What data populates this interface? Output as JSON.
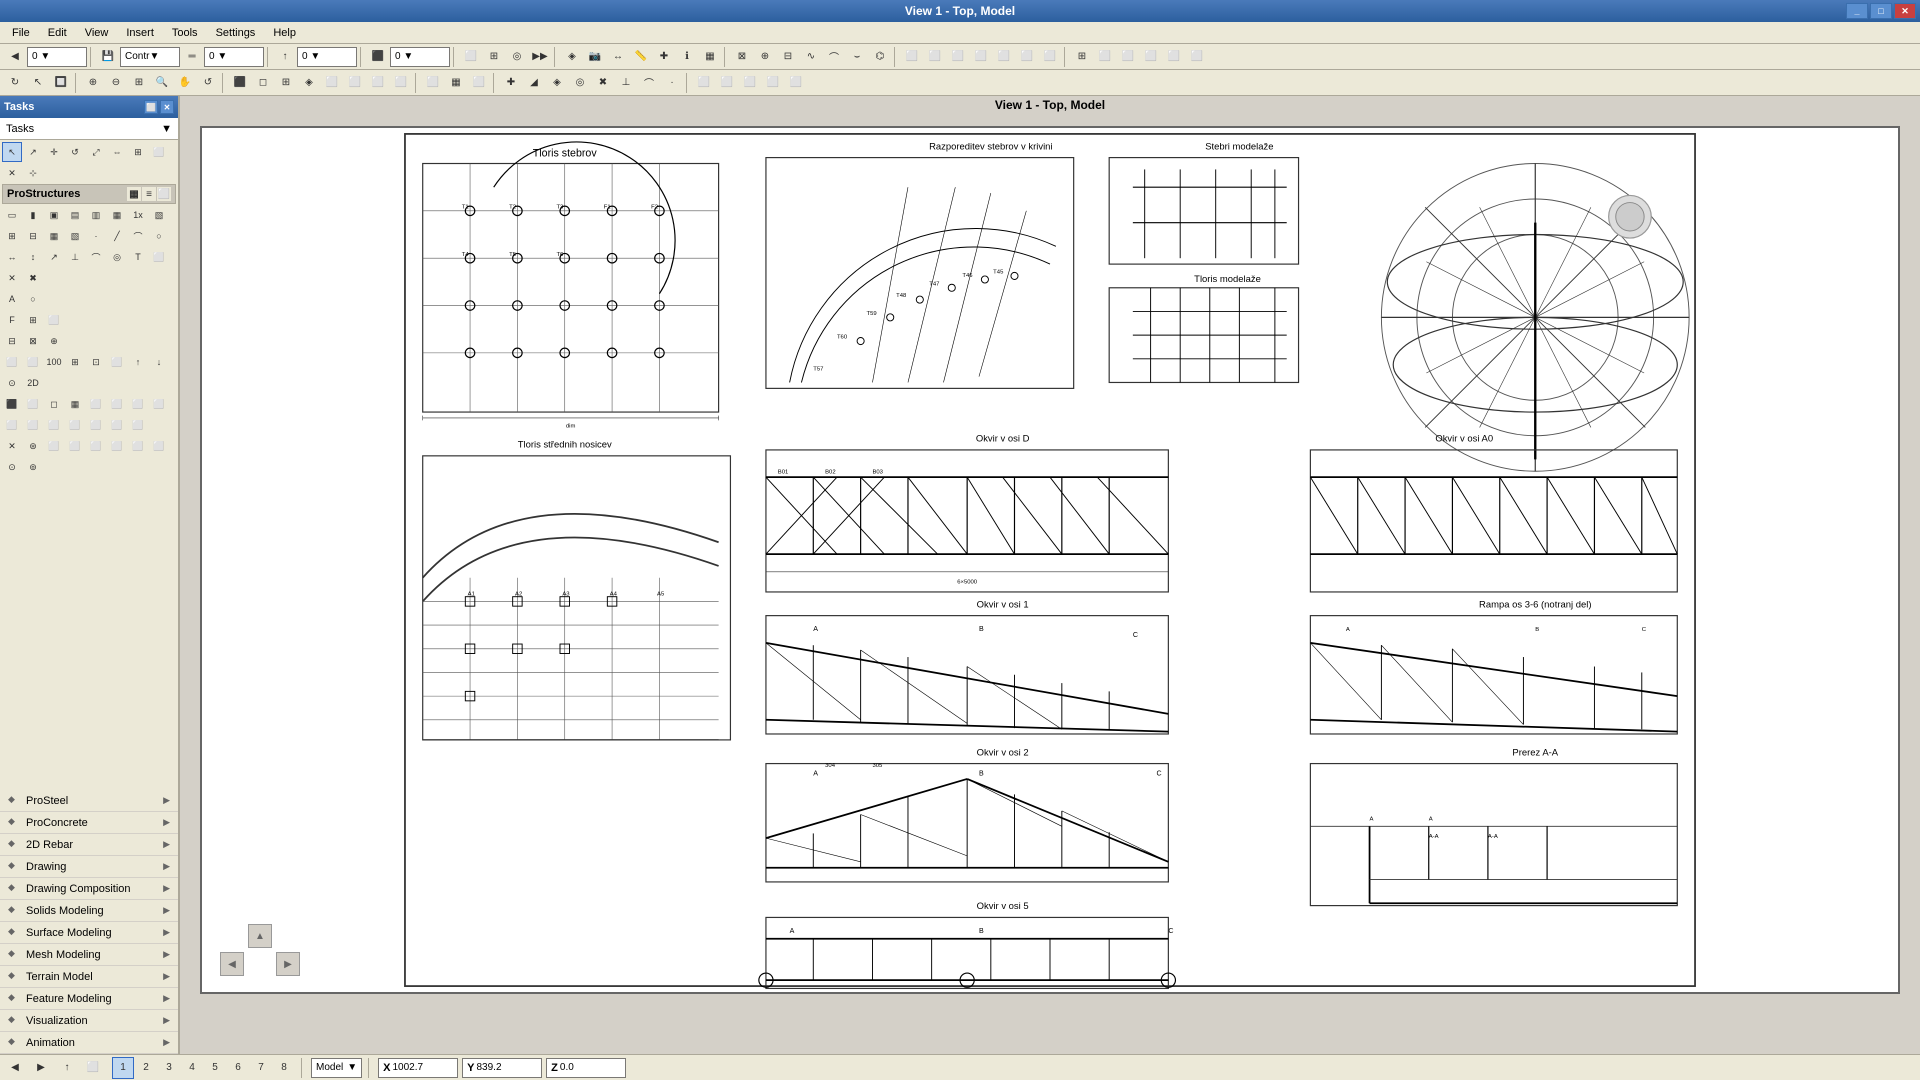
{
  "titlebar": {
    "title": "View 1 - Top, Model"
  },
  "toolbar1": {
    "dropdowns": [
      "▼",
      "0",
      "Contr▼",
      "0",
      "0",
      "0",
      "0"
    ],
    "buttons": [
      "⬛",
      "◻",
      "↩",
      "↪",
      "▶",
      "⏺",
      "📐",
      "🔧"
    ]
  },
  "toolbar2": {
    "buttons": [
      "↖",
      "↙",
      "➡",
      "⊕",
      "⊖",
      "🔲",
      "📊",
      "📋",
      "◯",
      "📏",
      "📐",
      "⬛",
      "▽",
      "△",
      "⬜",
      "❯",
      "⬜",
      "⬜",
      "⬜",
      "ℹ",
      "🔍"
    ]
  },
  "tasks_panel": {
    "header": "Tasks",
    "dropdown_label": "Tasks"
  },
  "prostructures": {
    "label": "ProStructures",
    "view_icons": [
      "grid",
      "list",
      "expand"
    ]
  },
  "tool_rows": [
    [
      "arrow",
      "select",
      "move",
      "rotate",
      "scale",
      "mirror",
      "align",
      "attach"
    ],
    [
      "x",
      "cursor"
    ],
    [
      "draw1",
      "draw2",
      "draw3",
      "draw4",
      "draw5",
      "draw6",
      "draw7",
      "draw8"
    ],
    [
      "t1",
      "t2",
      "t3",
      "t4",
      "t5",
      "t6",
      "1x",
      "t7"
    ],
    [
      "m1",
      "m2",
      "m3",
      "m4",
      "m5",
      "m6",
      "m7",
      "m8"
    ],
    [
      "c1",
      "c2",
      "c3",
      "c4",
      "c5",
      "c6",
      "c7",
      "c8"
    ],
    [
      "m3sq",
      "m2"
    ],
    [
      "dim1",
      "dim2",
      "dim3",
      "dim4",
      "dim5",
      "dim6",
      "dim7",
      "dim8"
    ],
    [
      "x2",
      "x3"
    ],
    [
      "A",
      "circ1"
    ],
    [
      "F",
      "G",
      "H"
    ],
    [
      "I",
      "J",
      "K"
    ],
    [
      "L",
      "M",
      "N",
      "O",
      "P",
      "Q",
      "R"
    ],
    [
      "2D"
    ],
    [
      "S1",
      "S2",
      "S3",
      "S4",
      "S5",
      "S6",
      "S7",
      "S8"
    ],
    [
      "T1",
      "T2",
      "T3",
      "T4",
      "T5",
      "T6",
      "T7"
    ],
    [
      "U1",
      "U2",
      "U3",
      "U4",
      "U5",
      "U6",
      "U7",
      "U8"
    ],
    [
      "V1",
      "V2",
      "circ2"
    ]
  ],
  "sidebar_items": [
    {
      "label": "ProSteel",
      "has_chevron": true,
      "icon": "◆"
    },
    {
      "label": "ProConcrete",
      "has_chevron": true,
      "icon": "◆"
    },
    {
      "label": "2D Rebar",
      "has_chevron": true,
      "icon": "◆"
    },
    {
      "label": "Drawing",
      "has_chevron": true,
      "icon": "◆"
    },
    {
      "label": "Drawing Composition",
      "has_chevron": true,
      "icon": "◆"
    },
    {
      "label": "Solids Modeling",
      "has_chevron": true,
      "icon": "◆"
    },
    {
      "label": "Surface Modeling",
      "has_chevron": true,
      "icon": "◆"
    },
    {
      "label": "Mesh Modeling",
      "has_chevron": true,
      "icon": "◆"
    },
    {
      "label": "Terrain Model",
      "has_chevron": true,
      "icon": "◆"
    },
    {
      "label": "Feature Modeling",
      "has_chevron": true,
      "icon": "◆"
    },
    {
      "label": "Visualization",
      "has_chevron": true,
      "icon": "◆"
    },
    {
      "label": "Animation",
      "has_chevron": true,
      "icon": "◆"
    }
  ],
  "drawing_labels": {
    "tlors_stebrov": "Tloris stebrov",
    "razporeditev": "Razporeditev stebrov v krivini",
    "stebri_modelaze": "Stebri modelaže",
    "tloris_modelaze": "Tloris modelaže",
    "okvir_osi_d": "Okvir v osi D",
    "okvir_osi_a0": "Okvir v osi A0",
    "tlors_srednih": "Tloris střednih nosicev",
    "okvir_osi_1": "Okvir v osi 1",
    "rampa": "Rampa os 3-6 (notranj del)",
    "okvir_osi_2": "Okvir v osi 2",
    "prerez_aa": "Prerez A-A",
    "okvir_osi_5": "Okvir v osi 5"
  },
  "statusbar": {
    "model_label": "Model",
    "x_label": "X",
    "x_value": "1002.7",
    "y_label": "Y",
    "y_value": "839.2",
    "z_label": "Z",
    "z_value": "0.0",
    "tabs": [
      "1",
      "2",
      "3",
      "4",
      "5",
      "6",
      "7",
      "8"
    ]
  }
}
